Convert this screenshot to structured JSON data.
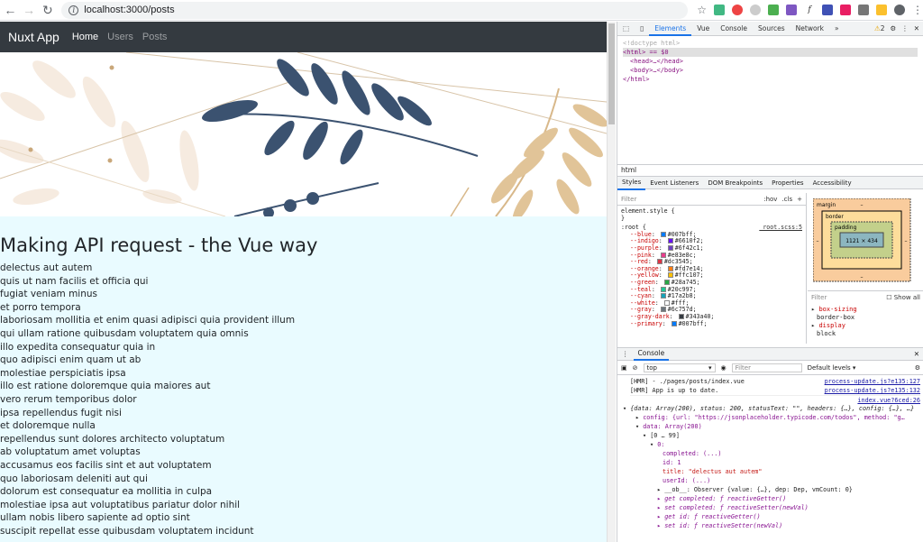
{
  "browser": {
    "url": "localhost:3000/posts",
    "extensions": [
      "ext-a",
      "ext-b",
      "ext-c",
      "ext-d",
      "ext-e",
      "ext-f",
      "ext-g",
      "ext-h",
      "ext-i"
    ]
  },
  "app": {
    "brand": "Nuxt App",
    "nav": [
      {
        "label": "Home"
      },
      {
        "label": "Users"
      },
      {
        "label": "Posts"
      }
    ],
    "heading": "Making API request - the Vue way",
    "todos": [
      "delectus aut autem",
      "quis ut nam facilis et officia qui",
      "fugiat veniam minus",
      "et porro tempora",
      "laboriosam mollitia et enim quasi adipisci quia provident illum",
      "qui ullam ratione quibusdam voluptatem quia omnis",
      "illo expedita consequatur quia in",
      "quo adipisci enim quam ut ab",
      "molestiae perspiciatis ipsa",
      "illo est ratione doloremque quia maiores aut",
      "vero rerum temporibus dolor",
      "ipsa repellendus fugit nisi",
      "et doloremque nulla",
      "repellendus sunt dolores architecto voluptatum",
      "ab voluptatum amet voluptas",
      "accusamus eos facilis sint et aut voluptatem",
      "quo laboriosam deleniti aut qui",
      "dolorum est consequatur ea mollitia in culpa",
      "molestiae ipsa aut voluptatibus pariatur dolor nihil",
      "ullam nobis libero sapiente ad optio sint",
      "suscipit repellat esse quibusdam voluptatem incidunt"
    ]
  },
  "devtools": {
    "tabs": [
      "Elements",
      "Vue",
      "Console",
      "Sources",
      "Network",
      "»"
    ],
    "warnings": "2",
    "tree": [
      "<!doctype html>",
      "<html> == $0",
      "<head>…</head>",
      "<body>…</body>",
      "</html>"
    ],
    "breadcrumb": "html",
    "sub_tabs": [
      "Styles",
      "Event Listeners",
      "DOM Breakpoints",
      "Properties",
      "Accessibility"
    ],
    "filter_placeholder": "Filter",
    "hov": ":hov",
    "cls": ".cls",
    "element_style": "element.style {",
    "element_style_close": "}",
    "root_selector": ":root {",
    "root_source": "_root.scss:5",
    "vars": [
      {
        "name": "--blue",
        "color": "#007bff"
      },
      {
        "name": "--indigo",
        "color": "#6610f2"
      },
      {
        "name": "--purple",
        "color": "#6f42c1"
      },
      {
        "name": "--pink",
        "color": "#e83e8c"
      },
      {
        "name": "--red",
        "color": "#dc3545"
      },
      {
        "name": "--orange",
        "color": "#fd7e14"
      },
      {
        "name": "--yellow",
        "color": "#ffc107"
      },
      {
        "name": "--green",
        "color": "#28a745"
      },
      {
        "name": "--teal",
        "color": "#20c997"
      },
      {
        "name": "--cyan",
        "color": "#17a2b8"
      },
      {
        "name": "--white",
        "color": "#fff"
      },
      {
        "name": "--gray",
        "color": "#6c757d"
      },
      {
        "name": "--gray-dark",
        "color": "#343a40"
      },
      {
        "name": "--primary",
        "color": "#007bff"
      }
    ],
    "box_model": {
      "margin": "margin",
      "border": "border",
      "padding": "padding",
      "content": "1121 × 434",
      "dash": "–"
    },
    "computed_filter": "Filter",
    "show_all": "Show all",
    "computed_props": [
      {
        "name": "box-sizing",
        "value": "border-box"
      },
      {
        "name": "display",
        "value": "block"
      }
    ],
    "console_tab": "Console",
    "console_context": "top",
    "console_filter": "Filter",
    "console_levels": "Default levels ▾",
    "console_lines": [
      {
        "text": "[HMR]  - ./pages/posts/index.vue",
        "src": "process-update.js?e135:127"
      },
      {
        "text": "[HMR] App is up to date.",
        "src": "process-update.js?e135:132"
      }
    ],
    "log_source": "index.vue?6ced:26",
    "log_summary": "{data: Array(200), status: 200, statusText: \"\", headers: {…}, config: {…}, …}",
    "log_config": "config: {url: \"https://jsonplaceholder.typicode.com/todos\", method: \"g…",
    "log_data": "data: Array(200)",
    "log_range": "[0 … 99]",
    "log_index": "0:",
    "log_completed": "completed: (...)",
    "log_id": "id: 1",
    "log_title": "title: \"delectus aut autem\"",
    "log_userid": "userId: (...)",
    "log_ob": "__ob__: Observer {value: {…}, dep: Dep, vmCount: 0}",
    "log_get_completed": "get completed: ƒ reactiveGetter()",
    "log_set_completed": "set completed: ƒ reactiveSetter(newVal)",
    "log_get_id": "get id: ƒ reactiveGetter()",
    "log_set_id": "set id: ƒ reactiveSetter(newVal)"
  }
}
